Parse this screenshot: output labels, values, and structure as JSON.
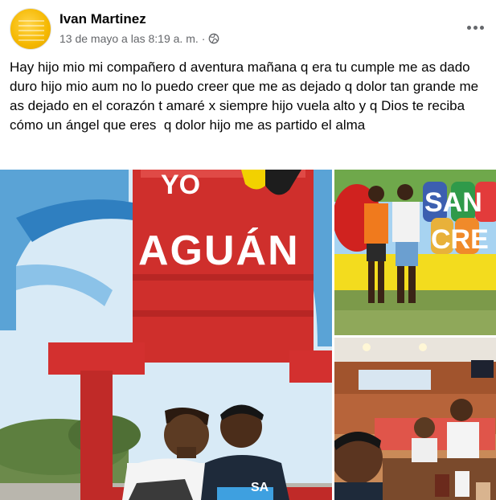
{
  "post": {
    "author": "Ivan Martinez",
    "timestamp": "13 de mayo a las 8:19 a. m.",
    "separator": "·",
    "privacy_icon": "globe-icon",
    "more_icon": "more-options-icon",
    "text": "Hay hijo mio mi compañero d aventura mañana q era tu cumple me as dado duro hijo mio aum no lo puedo creer que me as dejado q dolor tan grande me as dejado en el corazón t amaré x siempre hijo vuela alto y q Dios te reciba cómo un ángel que eres  q dolor hijo me as partido el alma"
  },
  "photos": {
    "main": {
      "sign_top": "YO",
      "sign_main": "AGUÁN",
      "shirt_text": "SA"
    },
    "top_right": {
      "sign_text": "SAN",
      "sign_text2": "CRE"
    }
  },
  "colors": {
    "text_primary": "#050505",
    "text_secondary": "#65676b",
    "avatar_yellow": "#f5b800",
    "chair_red": "#d3302f"
  }
}
